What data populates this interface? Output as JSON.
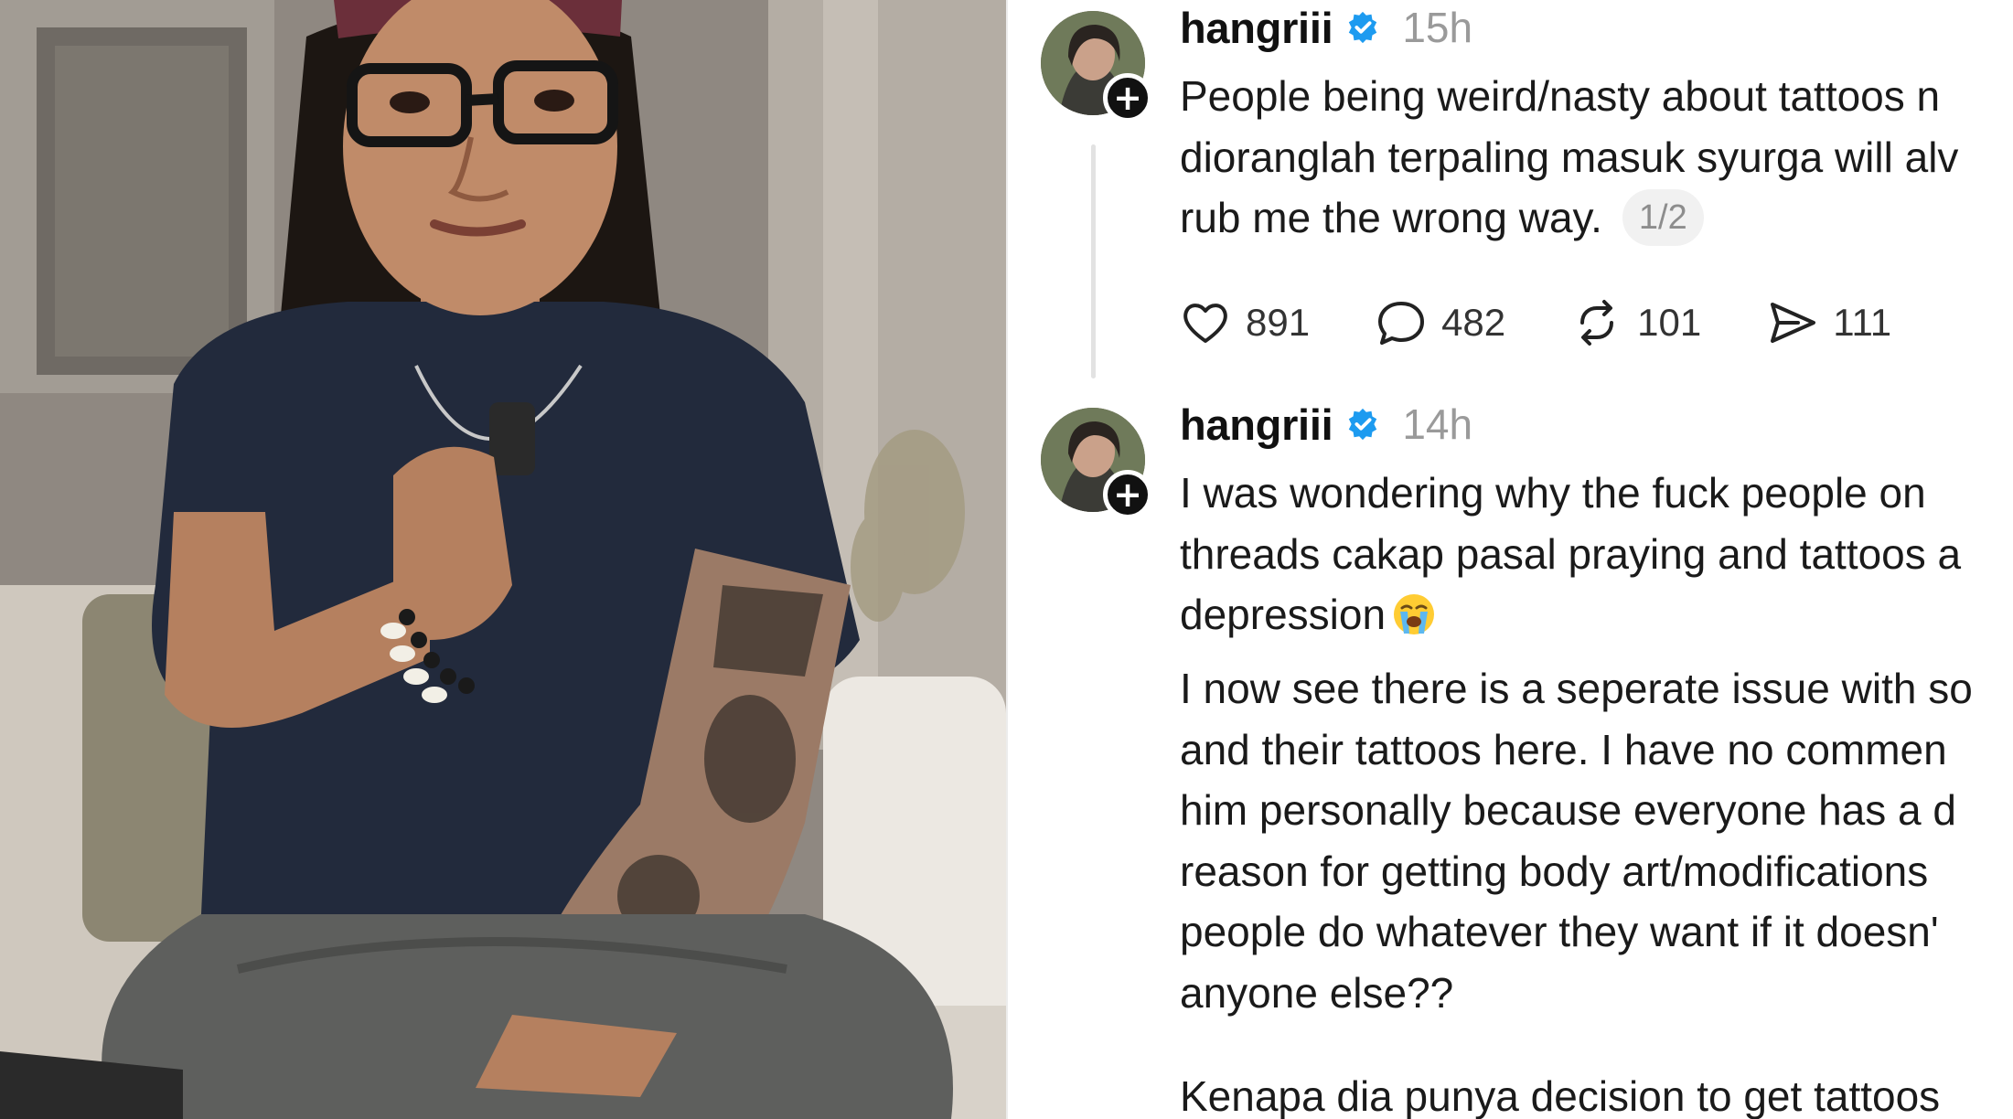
{
  "posts": [
    {
      "username": "hangriii",
      "timestamp": "15h",
      "lines": [
        "People being weird/nasty about tattoos n",
        "dioranglah terpaling masuk syurga will alv",
        "rub me the wrong way."
      ],
      "page_indicator": "1/2",
      "actions": {
        "likes": "891",
        "replies": "482",
        "reposts": "101",
        "shares": "111"
      }
    },
    {
      "username": "hangriii",
      "timestamp": "14h",
      "lines": [
        "I was wondering why the fuck people on",
        "threads cakap pasal praying and tattoos a",
        "depression"
      ],
      "paragraph2": [
        "I now see there is a seperate issue with so",
        "and their tattoos here. I have no commen",
        "him personally because everyone has a d",
        "reason for getting body art/modifications",
        "people do whatever they want if it doesn'",
        "anyone else??"
      ],
      "paragraph3": [
        "Kenapa dia punya decision to get tattoos"
      ]
    }
  ],
  "icons": {
    "verified": "verified-badge-icon",
    "follow": "plus-icon",
    "like": "heart-icon",
    "reply": "comment-bubble-icon",
    "repost": "repost-icon",
    "share": "send-icon",
    "emoji": "loudly-crying-face-emoji"
  },
  "colors": {
    "verified_blue": "#1d9bf0",
    "muted_text": "#9a9a9a",
    "thread_line": "#e2e2e2"
  }
}
